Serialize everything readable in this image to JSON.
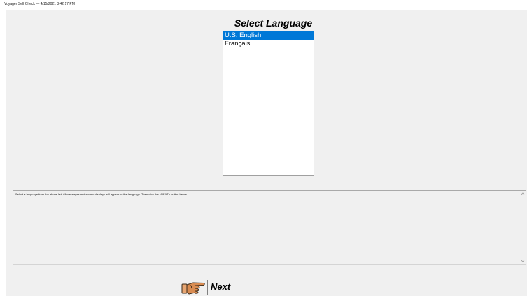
{
  "window": {
    "title": "Voyager Self Check  —  4/15/2021 3:42:17 PM"
  },
  "language_dialog": {
    "title": "Select Language",
    "options": [
      "U.S. English",
      "Français"
    ],
    "selected": "U.S. English"
  },
  "message": {
    "text": "Select a language from the above list.  All messages and screen displays will appear in that language.  Then click the <NEXT> button below."
  },
  "next_button": {
    "label": "Next",
    "icon": "pointing-hand-icon"
  },
  "colors": {
    "selection": "#0078d7",
    "background": "#f0f0f0"
  }
}
